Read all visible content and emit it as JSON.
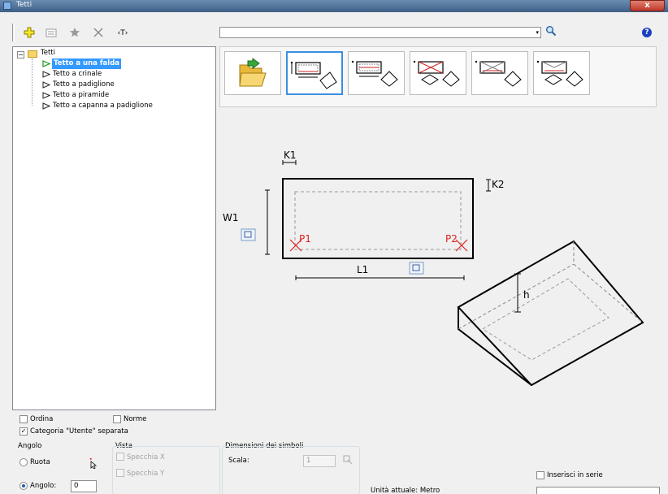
{
  "window": {
    "title": "Tetti",
    "close_label": "x"
  },
  "toolbar": {
    "add_icon": "plus-icon",
    "list_icon": "list-icon",
    "favorite_icon": "star-icon",
    "delete_icon": "x-icon",
    "text_icon_label": "‹T›",
    "search_value": "",
    "search_dropdown_glyph": "▾",
    "search_icon_glyph": "🔍",
    "help_label": "?"
  },
  "tree": {
    "root": "Tetti",
    "items": [
      {
        "label": "Tetto a una falda",
        "selected": true
      },
      {
        "label": "Tetto a crinale"
      },
      {
        "label": "Tetto a padiglione"
      },
      {
        "label": "Tetto a piramide"
      },
      {
        "label": "Tetto a capanna a padiglione"
      }
    ]
  },
  "diagram": {
    "k1": "K1",
    "k2": "K2",
    "w1": "W1",
    "l1": "L1",
    "p1": "P1",
    "p2": "P2",
    "h": "h"
  },
  "options": {
    "ordina": "Ordina",
    "norme": "Norme",
    "categoria": "Categoria \"Utente\" separata",
    "categoria_checked": true
  },
  "angolo": {
    "title": "Angolo",
    "ruota": "Ruota",
    "angolo_label": "Angolo:",
    "angolo_value": "0"
  },
  "vista": {
    "title": "Vista",
    "specchia_x": "Specchia X",
    "specchia_y": "Specchia Y"
  },
  "dimensioni": {
    "title": "Dimensioni dei simboli",
    "scala_label": "Scala:",
    "scala_value": "1",
    "unita": "Unità attuale: Metro"
  },
  "serie": {
    "label": "Inserisci in serie"
  },
  "colors": {
    "selection": "#3399ff",
    "accent": "#3c8ee0",
    "red_marker": "#e02020"
  }
}
